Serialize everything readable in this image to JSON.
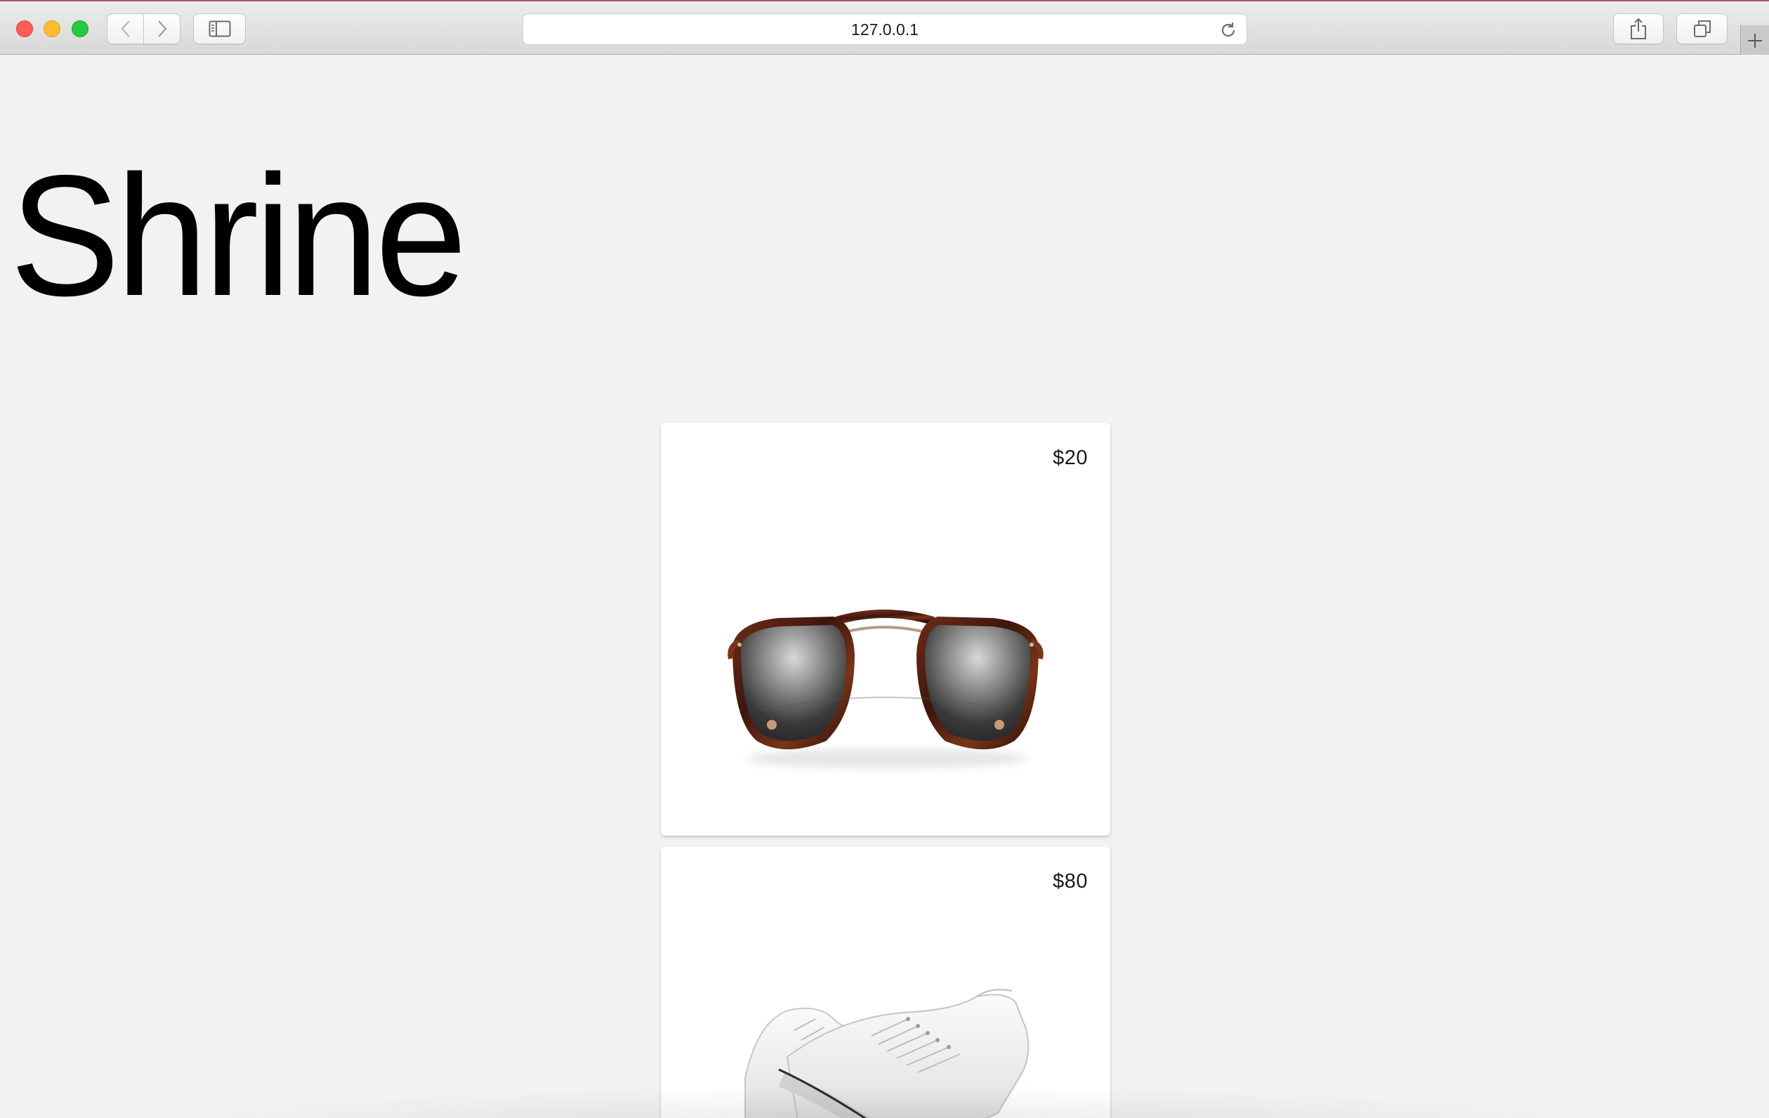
{
  "browser": {
    "address": "127.0.0.1"
  },
  "page": {
    "logo": "Shrine",
    "products": [
      {
        "price": "$20",
        "image": "sunglasses"
      },
      {
        "price": "$80",
        "image": "white-sneakers"
      }
    ]
  }
}
